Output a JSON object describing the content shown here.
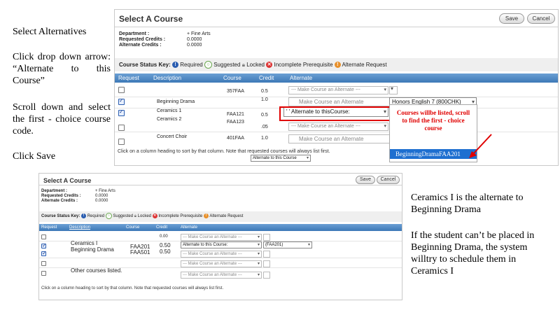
{
  "instructions": {
    "step1": "Select  Alternatives",
    "step2": "Click  drop  down arrow:  “Alternate  to this  Course”",
    "step3": "Scroll  down  and select  the  first - choice  course code.",
    "step4": "Click  Save"
  },
  "top_panel": {
    "title": "Select A Course",
    "save_label": "Save",
    "cancel_label": "Cancel",
    "department_label": "Department :",
    "department_value": "+ Fine Arts",
    "requested_label": "Requested Credits :",
    "requested_value": "0.0000",
    "alternate_label": "Alternate Credits :",
    "alternate_value": "0.0000",
    "key_label": "Course Status Key:",
    "key_required": "Required",
    "key_suggested": "Suggested",
    "key_locked": "Locked",
    "key_incomplete": "Incomplete Prerequisite",
    "key_altreq": "Alternate Request",
    "columns": [
      "Request",
      "Description",
      "Course",
      "Credit",
      "Alternate"
    ],
    "rows": [
      {
        "checked": false,
        "description": "",
        "course": "357FAA",
        "credit": "0.5",
        "alternate": "--- Make Course an Alternate ---"
      },
      {
        "checked": true,
        "description": "Beginning        Drama",
        "course": "",
        "credit": "1.0",
        "alternate": "Make Course an Alternate"
      },
      {
        "checked": true,
        "description": "Ceramics      1",
        "course": "FAA121",
        "credit": "0.5",
        "alternate": "' ' Alternate to thisCourse:"
      },
      {
        "checked": false,
        "description": "Ceramics      2",
        "course": "FAA123",
        "credit": ".05",
        "alternate": "--- Make Course an Alternate ---"
      },
      {
        "checked": false,
        "description": "Concert        Choir",
        "course": "401FAA",
        "credit": "1.0",
        "alternate": "Make Course an Alternate"
      }
    ],
    "honors_select": "Honors English 7 (800CHK)",
    "popup_text": "Courses  willbe  listed, scroll  to  find  the  first - choice  course",
    "highlight_option": "BeginningDramaFAA201",
    "footnote": "Click on a column heading to sort by that column. Note that requested courses will always list first.",
    "bottom_select": "Alternate to this Course"
  },
  "bottom_panel": {
    "title": "Select A Course",
    "save_label": "Save",
    "cancel_label": "Cancel",
    "department_label": "Department :",
    "department_value": "+ Fine Arts",
    "requested_label": "Requested Credits :",
    "requested_value": "0.0000",
    "alternate_label": "Alternate Credits :",
    "alternate_value": "0.0000",
    "key_label": "Course Status Key:",
    "key_required": "Required",
    "key_suggested": "Suggested",
    "key_locked": "Locked",
    "key_incomplete": "Incomplete Prerequisite",
    "key_altreq": "Alternate Request",
    "columns": [
      "Request",
      "Description",
      "Course",
      "Credit",
      "Alternate"
    ],
    "rows": [
      {
        "checked": false,
        "description": "",
        "course": "",
        "credit": "0.00",
        "alternate": "--- Make Course an Alternate ---"
      },
      {
        "checked": true,
        "description": "Ceramics  I",
        "course": "FAA201",
        "credit": "0.50",
        "alternate": "Alternate to this Course:"
      },
      {
        "checked": true,
        "description": "Beginning Drama",
        "course": "FAA501",
        "credit": "0.50",
        "alternate": "--- Make Course an Alternate ---"
      },
      {
        "checked": false,
        "description": "",
        "course": "",
        "credit": "",
        "alternate": "--- Make Course an Alternate ---"
      },
      {
        "checked": false,
        "description": "Other courses listed.",
        "course": "",
        "credit": "",
        "alternate": "--- Make Course an Alternate ---"
      }
    ],
    "alt_value": "(FAA201)",
    "footnote": "Click on a column heading to sort by that column. Note that requested courses will always list first."
  },
  "explanation": {
    "line1": "Ceramics  I is the  alternate   to Beginning   Drama",
    "line2": "If the  student   can’t be placed in  Beginning   Drama,  the system  willtry  to  schedule them  in  Ceramics  I"
  },
  "colors": {
    "header_blue": "#3d78b6",
    "red": "#e00000",
    "highlight": "#1e6fd0"
  }
}
